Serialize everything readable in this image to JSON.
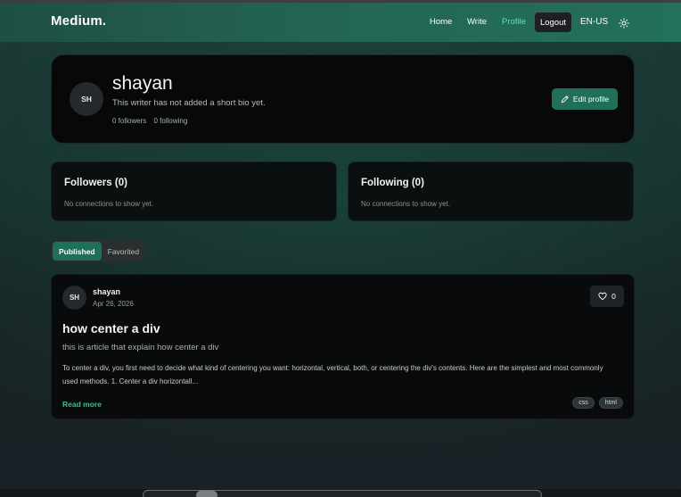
{
  "navbar": {
    "brand": "Medium.",
    "links": [
      "Home",
      "Write",
      "Profile"
    ],
    "active_link": "Profile",
    "logout_label": "Logout",
    "language": "EN-US",
    "theme_icon": "sun-icon"
  },
  "profile": {
    "initials": "SH",
    "username": "shayan",
    "bio": "This writer has not added a short bio yet.",
    "followers": "0 followers",
    "following": "0 following",
    "edit_label": "Edit profile"
  },
  "connections": {
    "followers_title": "Followers (0)",
    "following_title": "Following (0)",
    "empty_text": "No connections to show yet."
  },
  "tabs": {
    "items": [
      "Published",
      "Favorited"
    ],
    "active": "Published"
  },
  "article": {
    "initials": "SH",
    "author": "shayan",
    "date": "Apr 26, 2026",
    "likes": "0",
    "title": "how center a div",
    "description": "this is article that explain how center a div",
    "body": "To center a div, you first need to decide what kind of centering you want: horizontal, vertical, both, or centering the div's contents. Here are the simplest and most commonly used methods. 1. Center a div horizontall...",
    "read_more": "Read more",
    "tags": [
      "css",
      "html"
    ]
  },
  "colors": {
    "accent": "#1f6f5c",
    "active_link": "#5fe0b4",
    "read_more": "#3fbf8c"
  }
}
